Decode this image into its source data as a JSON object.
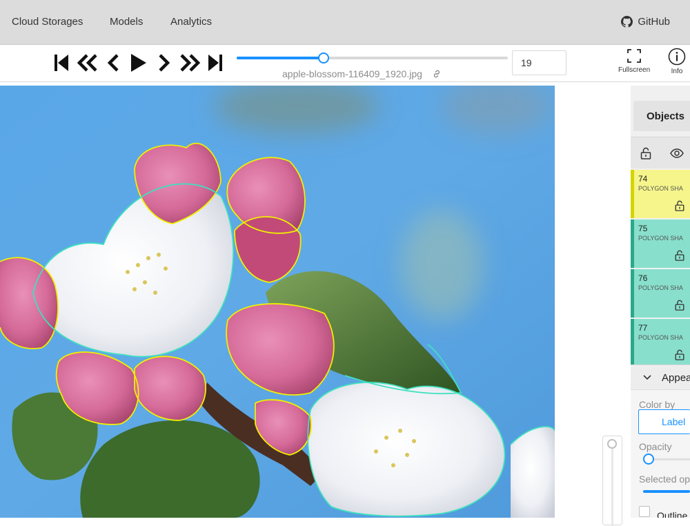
{
  "nav": {
    "links": [
      "Cloud Storages",
      "Models",
      "Analytics"
    ],
    "github_label": "GitHub"
  },
  "player": {
    "buttons": [
      "first-frame-icon",
      "fast-backward-icon",
      "previous-icon",
      "play-icon",
      "next-icon",
      "fast-forward-icon",
      "last-frame-icon"
    ],
    "progress": 0.32,
    "filename": "apple-blossom-116409_1920.jpg",
    "frame_value": "19",
    "fullscreen_label": "Fullscreen",
    "info_label": "Info"
  },
  "sidebar": {
    "tab_label": "Objects",
    "objects": [
      {
        "id": "74",
        "type": "POLYGON SHA",
        "color": "#f5f58b",
        "border": "#d4d400"
      },
      {
        "id": "75",
        "type": "POLYGON SHA",
        "color": "#88dfcc",
        "border": "#2aa88a"
      },
      {
        "id": "76",
        "type": "POLYGON SHA",
        "color": "#88dfcc",
        "border": "#2aa88a"
      },
      {
        "id": "77",
        "type": "POLYGON SHA",
        "color": "#88dfcc",
        "border": "#2aa88a"
      }
    ],
    "appearance": {
      "title": "Appea",
      "color_by_label": "Color by",
      "color_by_value": "Label",
      "opacity_label": "Opacity",
      "selected_label": "Selected op",
      "outline_label": "Outline"
    }
  },
  "colors": {
    "accent": "#1890ff",
    "polygon_yellow": "#f0f000",
    "polygon_teal": "#3fe0c0"
  }
}
